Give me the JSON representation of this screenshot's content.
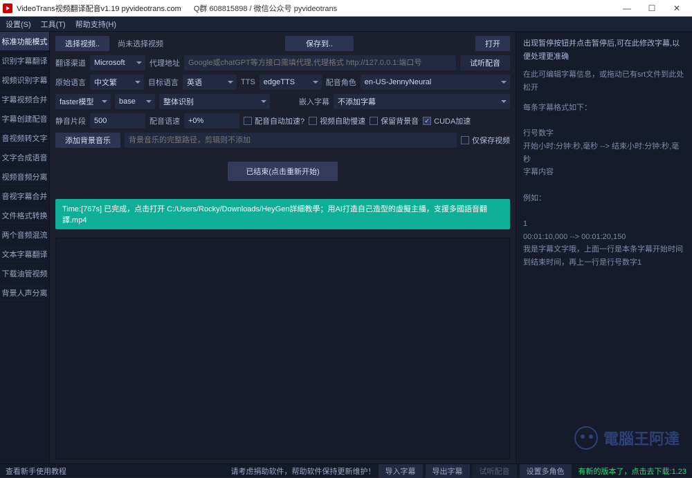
{
  "titlebar": {
    "title": "VideoTrans视频翻译配音v1.19  pyvideotrans.com",
    "sub": "Q群 608815898 / 微信公众号 pyvideotrans"
  },
  "menu": {
    "settings": "设置(S)",
    "tools": "工具(T)",
    "help": "帮助支持(H)"
  },
  "sidebar": [
    "标准功能模式",
    "识别字幕翻译",
    "视频识别字幕",
    "字幕视频合并",
    "字幕创建配音",
    "音视频转文字",
    "文字合成语音",
    "视频音频分离",
    "音视字幕合并",
    "文件格式转换",
    "两个音频混流",
    "文本字幕翻译",
    "下载油管视频",
    "背景人声分离"
  ],
  "toprow": {
    "select_video": "选择视频..",
    "no_video": "尚未选择视频",
    "save_to": "保存到..",
    "open": "打开"
  },
  "row2": {
    "channel_label": "翻译渠道",
    "channel_value": "Microsoft",
    "proxy_label": "代理地址",
    "proxy_placeholder": "Google或chatGPT等方接口需填代理,代理格式 http://127.0.0.1:端口号",
    "test_dub": "试听配音"
  },
  "row3": {
    "src_label": "原始语言",
    "src_value": "中文繁",
    "dst_label": "目标语言",
    "dst_value": "英语",
    "tts_label": "TTS",
    "tts_value": "edgeTTS",
    "voice_label": "配音角色",
    "voice_value": "en-US-JennyNeural"
  },
  "row4": {
    "model_label": "faster模型",
    "model_value": "base",
    "rec_label": "整体识别",
    "embed_label": "嵌入字幕",
    "embed_value": "不添加字幕"
  },
  "row5": {
    "silence_label": "静音片段",
    "silence_value": "500",
    "speed_label": "配音语速",
    "speed_value": "+0%",
    "auto_dub": "配音自动加速?",
    "auto_video": "视频自助慢速",
    "keep_bg": "保留背景音",
    "cuda": "CUDA加速",
    "cuda_on": true
  },
  "row6": {
    "add_bgm": "添加背景音乐",
    "bgm_placeholder": "背景音乐的完整路径，剪辑则不添加",
    "only_save_video": "仅保存视频"
  },
  "exec_btn": "已结束(点击重新开始)",
  "result_line": "Time:[767s] 已完成，点击打开 C:/Users/Rocky/Downloads/HeyGen詳細教學；用AI打造自己造型的虛擬主播，支援多國語音翻譯.mp4",
  "rightpanel": {
    "hd1": "出现暂停按钮并点击暂停后,可在此修改字幕,以便处理更准确",
    "hd2": "在此可编辑字幕信息，或拖动已有srt文件到此处松开",
    "line_format": "每条字幕格式如下：",
    "l1": "行号数字",
    "l2": "开始小时:分钟:秒,毫秒 --> 结束小时:分钟:秒,毫秒",
    "l3": "字幕内容",
    "eg": "例如：",
    "e1": "1",
    "e2": "00:01:10,000 --> 00:01:20,150",
    "e3": "我是字幕文字哦，上面一行是本条字幕开始时间到结束时间，再上一行是行号数字1"
  },
  "status": {
    "left": "查看新手使用教程",
    "mid": "请考虑捐助软件，帮助软件保持更新维护！",
    "b1": "导入字幕",
    "b2": "导出字幕",
    "b3": "试听配音",
    "b4": "设置多角色",
    "update": "有新的版本了，点击去下载:1.23"
  },
  "watermark": "電腦王阿達"
}
